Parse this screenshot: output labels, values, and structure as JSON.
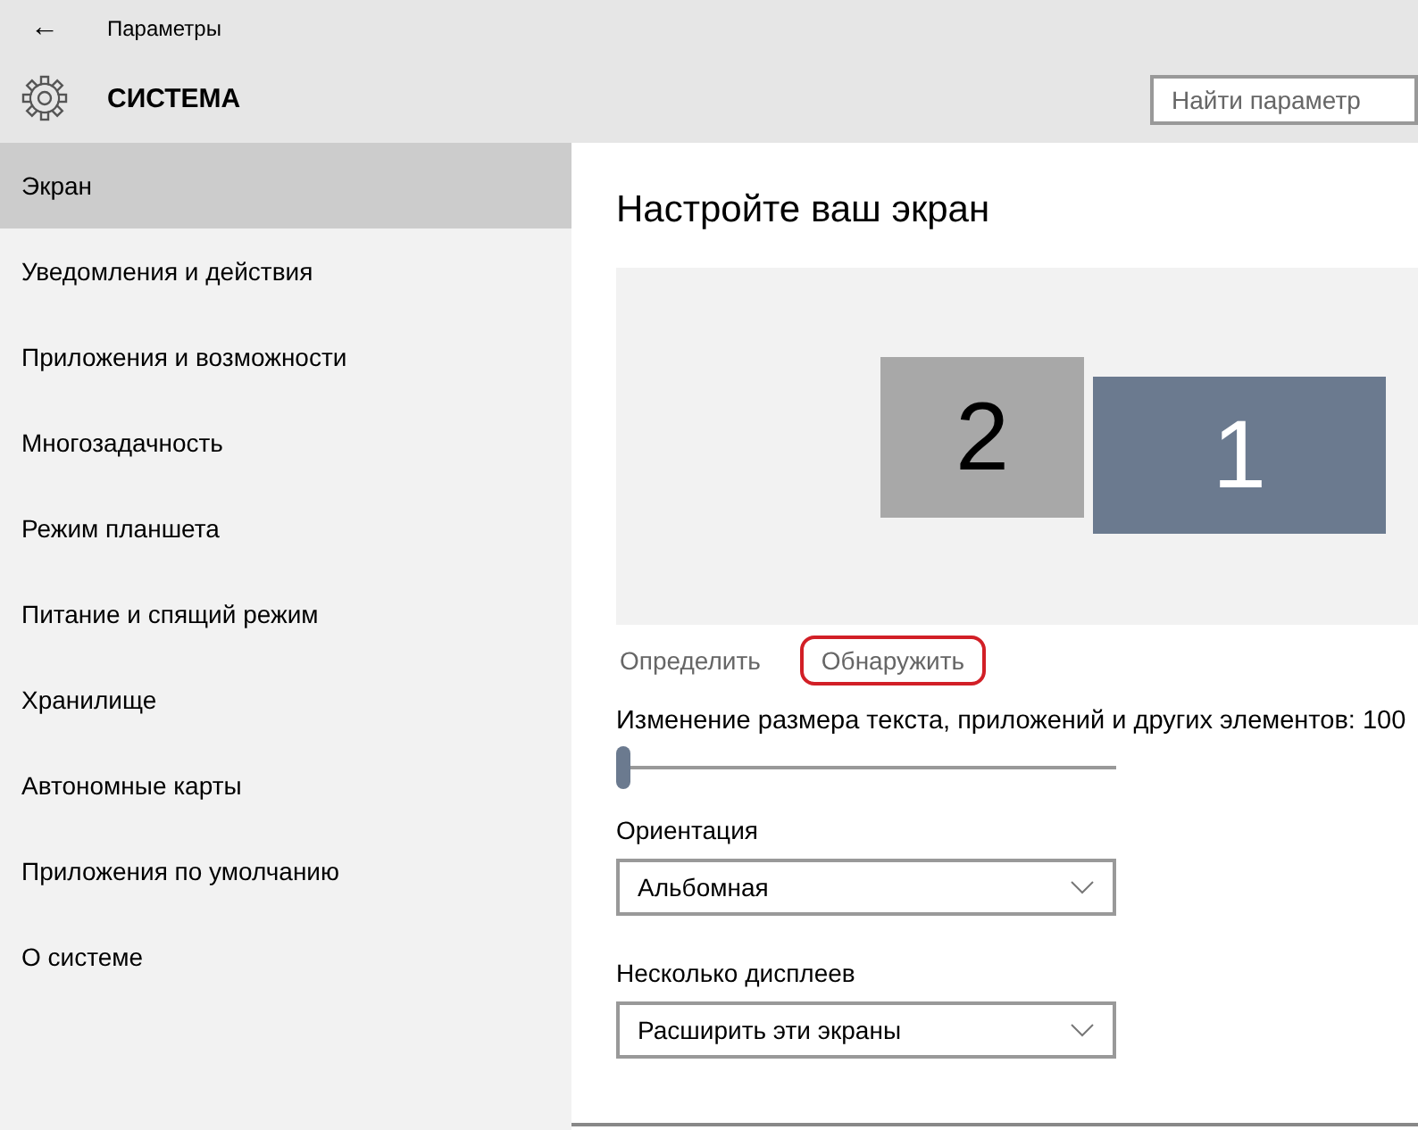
{
  "window": {
    "title": "Параметры",
    "back_glyph": "←"
  },
  "header": {
    "title": "СИСТЕМА",
    "search": {
      "placeholder": "Найти параметр"
    }
  },
  "sidebar": {
    "items": [
      {
        "label": "Экран",
        "selected": true
      },
      {
        "label": "Уведомления и действия",
        "selected": false
      },
      {
        "label": "Приложения и возможности",
        "selected": false
      },
      {
        "label": "Многозадачность",
        "selected": false
      },
      {
        "label": "Режим планшета",
        "selected": false
      },
      {
        "label": "Питание и спящий режим",
        "selected": false
      },
      {
        "label": "Хранилище",
        "selected": false
      },
      {
        "label": "Автономные карты",
        "selected": false
      },
      {
        "label": "Приложения по умолчанию",
        "selected": false
      },
      {
        "label": "О системе",
        "selected": false
      }
    ]
  },
  "content": {
    "title": "Настройте ваш экран",
    "displays": [
      {
        "number": "2",
        "selected": false
      },
      {
        "number": "1",
        "selected": true
      }
    ],
    "links": [
      {
        "label": "Определить",
        "highlighted": false
      },
      {
        "label": "Обнаружить",
        "highlighted": true
      }
    ],
    "scale": {
      "label": "Изменение размера текста, приложений и других элементов: 100",
      "level": 0
    },
    "dropdowns": [
      {
        "label": "Ориентация",
        "value": "Альбомная"
      },
      {
        "label": "Несколько дисплеев",
        "value": "Расширить эти экраны"
      }
    ]
  }
}
